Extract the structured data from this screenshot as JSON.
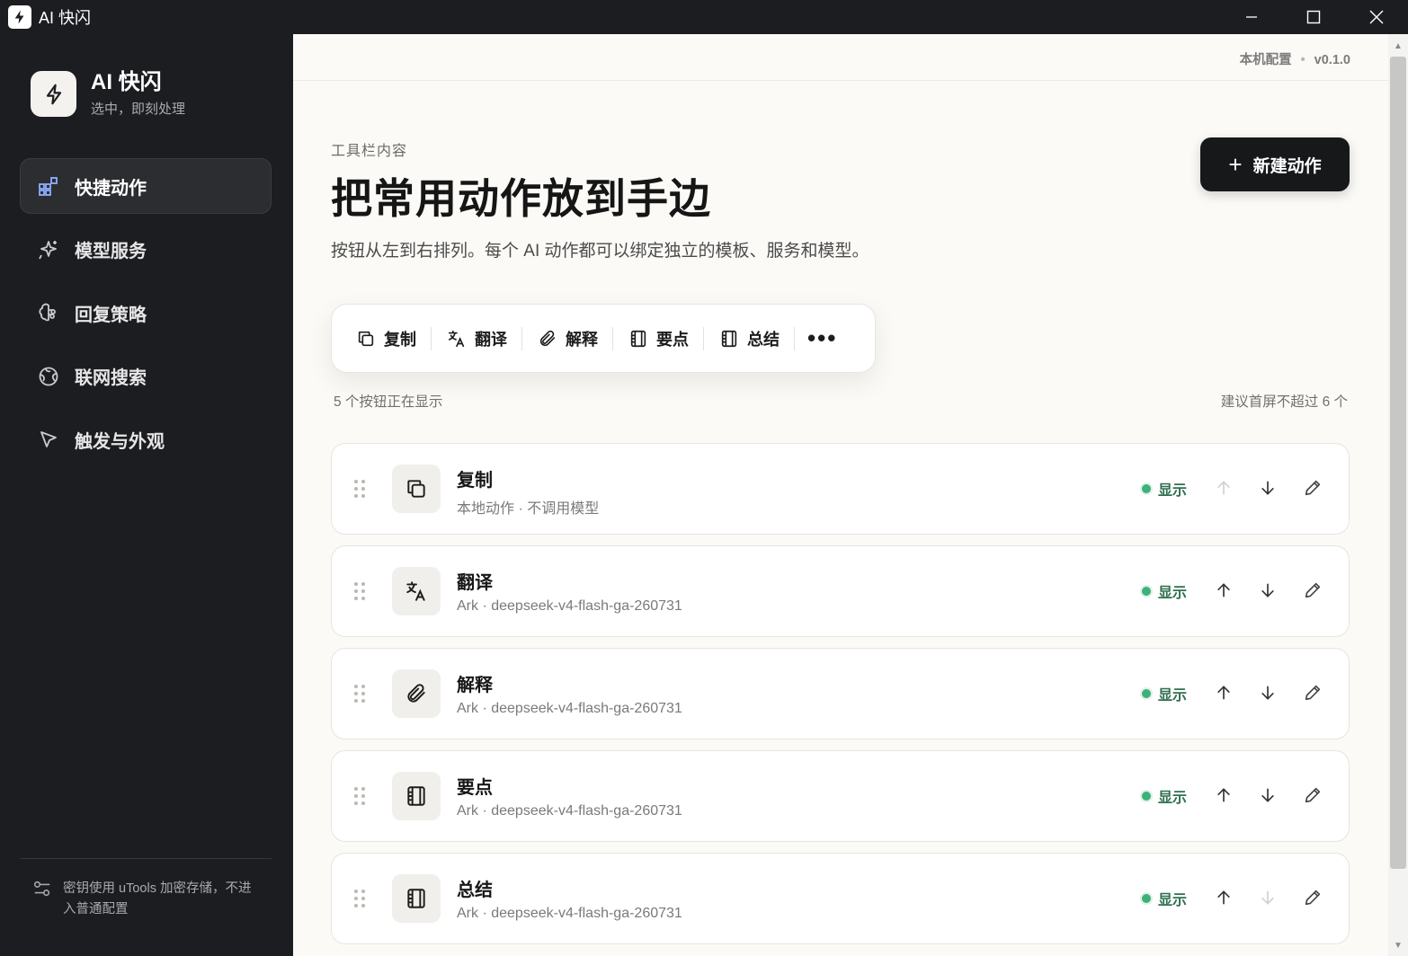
{
  "window": {
    "title": "AI 快闪"
  },
  "brand": {
    "name": "AI 快闪",
    "tagline": "选中，即刻处理"
  },
  "nav": {
    "items": [
      {
        "label": "快捷动作",
        "icon": "shortcut-grid-icon",
        "active": true
      },
      {
        "label": "模型服务",
        "icon": "sparkle-icon",
        "active": false
      },
      {
        "label": "回复策略",
        "icon": "brain-icon",
        "active": false
      },
      {
        "label": "联网搜索",
        "icon": "globe-icon",
        "active": false
      },
      {
        "label": "触发与外观",
        "icon": "cursor-icon",
        "active": false
      }
    ]
  },
  "footer_note": "密钥使用 uTools 加密存储，不进入普通配置",
  "topbar": {
    "config_label": "本机配置",
    "separator": "•",
    "version": "v0.1.0"
  },
  "header": {
    "eyebrow": "工具栏内容",
    "title": "把常用动作放到手边",
    "description": "按钮从左到右排列。每个 AI 动作都可以绑定独立的模板、服务和模型。",
    "new_button": "新建动作"
  },
  "toolbar_preview": {
    "buttons": [
      {
        "label": "复制",
        "icon": "copy-icon"
      },
      {
        "label": "翻译",
        "icon": "translate-icon"
      },
      {
        "label": "解释",
        "icon": "paperclip-icon"
      },
      {
        "label": "要点",
        "icon": "notebook-icon"
      },
      {
        "label": "总结",
        "icon": "notebook-icon"
      }
    ],
    "more": "•••"
  },
  "counts": {
    "left": "5 个按钮正在显示",
    "right": "建议首屏不超过 6 个"
  },
  "actions": [
    {
      "name": "复制",
      "meta": "本地动作 · 不调用模型",
      "status": "显示",
      "icon": "copy-icon",
      "can_up": false,
      "can_down": true
    },
    {
      "name": "翻译",
      "meta": "Ark · deepseek-v4-flash-ga-260731",
      "status": "显示",
      "icon": "translate-icon",
      "can_up": true,
      "can_down": true
    },
    {
      "name": "解释",
      "meta": "Ark · deepseek-v4-flash-ga-260731",
      "status": "显示",
      "icon": "paperclip-icon",
      "can_up": true,
      "can_down": true
    },
    {
      "name": "要点",
      "meta": "Ark · deepseek-v4-flash-ga-260731",
      "status": "显示",
      "icon": "notebook-icon",
      "can_up": true,
      "can_down": true
    },
    {
      "name": "总结",
      "meta": "Ark · deepseek-v4-flash-ga-260731",
      "status": "显示",
      "icon": "notebook-icon",
      "can_up": true,
      "can_down": false
    }
  ],
  "colors": {
    "sidebar_bg": "#1c1d20",
    "main_bg": "#fbfaf6",
    "primary_button": "#17181a",
    "status_green": "#3fb07a",
    "nav_active_icon": "#8fb0ff"
  }
}
